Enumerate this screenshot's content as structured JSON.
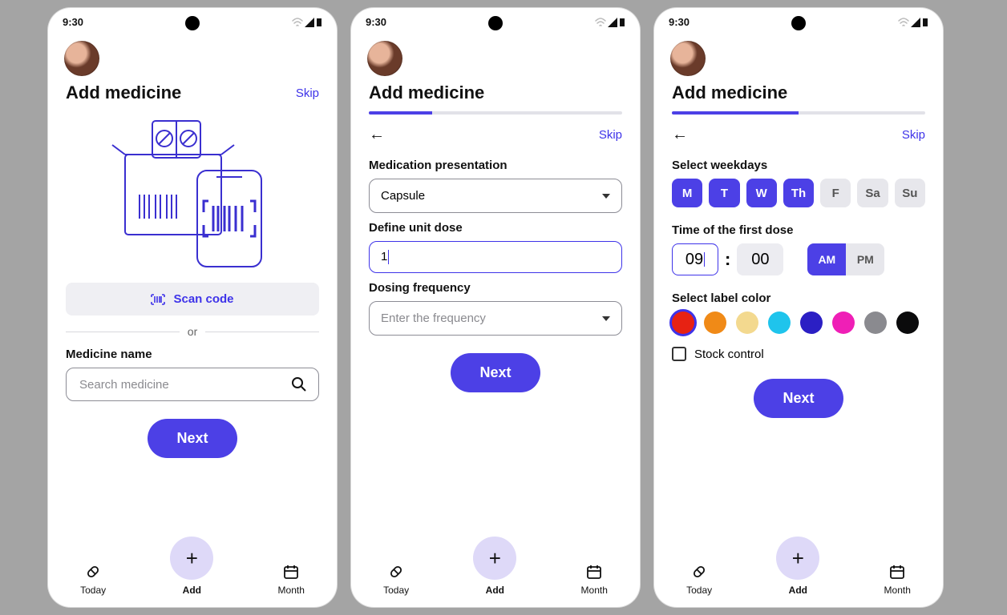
{
  "status": {
    "time": "9:30"
  },
  "screens": {
    "s1": {
      "title": "Add medicine",
      "skip": "Skip",
      "scan_label": "Scan code",
      "or": "or",
      "medicine_name_label": "Medicine name",
      "search_placeholder": "Search medicine",
      "next": "Next"
    },
    "s2": {
      "title": "Add medicine",
      "skip": "Skip",
      "presentation_label": "Medication presentation",
      "presentation_value": "Capsule",
      "unit_dose_label": "Define unit dose",
      "unit_dose_value": "1",
      "frequency_label": "Dosing frequency",
      "frequency_placeholder": "Enter the frequency",
      "next": "Next",
      "progress_pct": 25
    },
    "s3": {
      "title": "Add medicine",
      "skip": "Skip",
      "weekdays_label": "Select weekdays",
      "weekdays": [
        {
          "abbr": "M",
          "selected": true
        },
        {
          "abbr": "T",
          "selected": true
        },
        {
          "abbr": "W",
          "selected": true
        },
        {
          "abbr": "Th",
          "selected": true
        },
        {
          "abbr": "F",
          "selected": false
        },
        {
          "abbr": "Sa",
          "selected": false
        },
        {
          "abbr": "Su",
          "selected": false
        }
      ],
      "time_label": "Time of the first dose",
      "time": {
        "hour": "09",
        "minute": "00",
        "am": "AM",
        "pm": "PM",
        "am_on": true
      },
      "color_label": "Select label color",
      "colors": [
        {
          "hex": "#e72213",
          "selected": true
        },
        {
          "hex": "#f08a17",
          "selected": false
        },
        {
          "hex": "#f3d98f",
          "selected": false
        },
        {
          "hex": "#1fc4ec",
          "selected": false
        },
        {
          "hex": "#2b1fc4",
          "selected": false
        },
        {
          "hex": "#ef1fb6",
          "selected": false
        },
        {
          "hex": "#8a8a8f",
          "selected": false
        },
        {
          "hex": "#0b0b0c",
          "selected": false
        }
      ],
      "stock_label": "Stock control",
      "next": "Next",
      "progress_pct": 50
    }
  },
  "nav": {
    "today": "Today",
    "add": "Add",
    "month": "Month"
  }
}
